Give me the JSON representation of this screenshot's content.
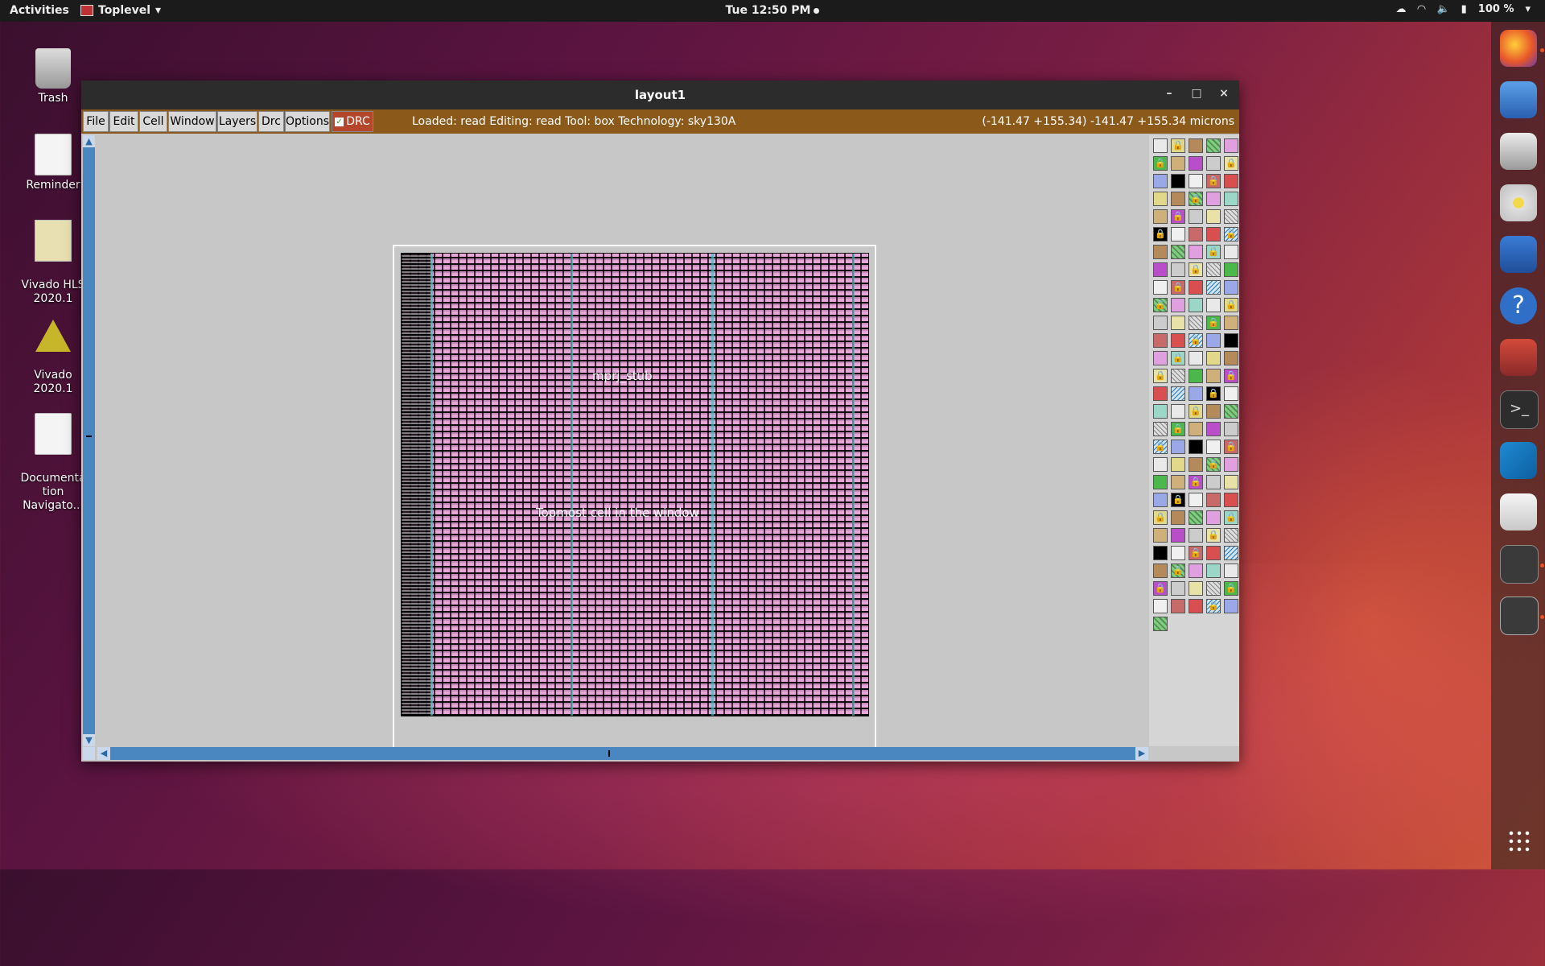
{
  "topbar": {
    "activities": "Activities",
    "app_name": "Toplevel",
    "clock": "Tue 12:50 PM",
    "battery": "100 %"
  },
  "desktop": {
    "icons": [
      {
        "label": "Trash"
      },
      {
        "label": "Reminder"
      },
      {
        "label": "Vivado HLS\n2020.1"
      },
      {
        "label": "Vivado\n2020.1"
      },
      {
        "label": "Documenta\ntion\nNavigato..."
      }
    ]
  },
  "window": {
    "title": "layout1",
    "menu": {
      "file": "File",
      "edit": "Edit",
      "cell": "Cell",
      "window": "Window",
      "layers": "Layers",
      "drc_menu": "Drc",
      "options": "Options",
      "drc_toggle": "DRC"
    },
    "status": "Loaded: read  Editing: read  Tool: box   Technology: sky130A",
    "coords": "(-141.47 +155.34) -141.47 +155.34 microns",
    "cell_labels": {
      "center": "mprj_stub",
      "lower": "Topmost cell in the window"
    }
  },
  "colors": {
    "menubar": "#8b5a1b",
    "drc_button": "#b4462b",
    "scrollbar": "#4a86c0",
    "layout_fill": "#d9a0cf"
  }
}
